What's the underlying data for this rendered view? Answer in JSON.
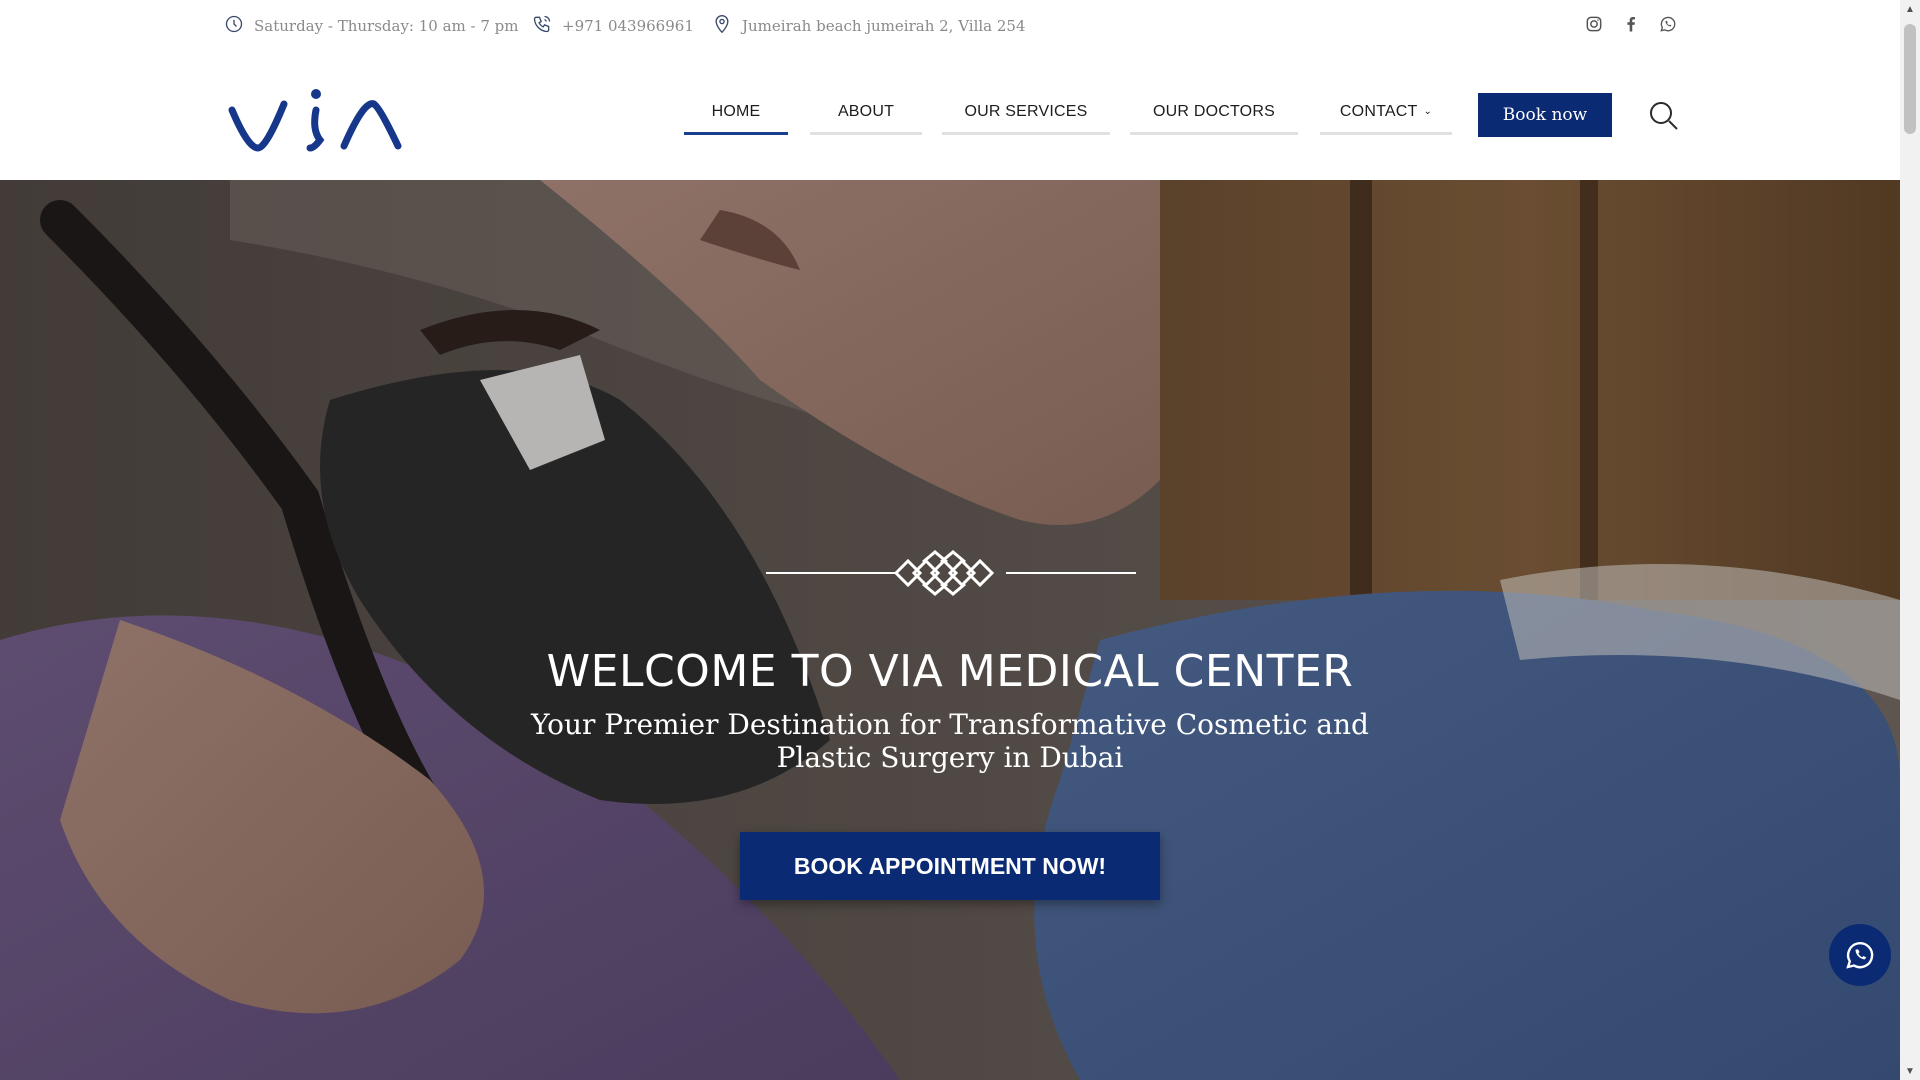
{
  "topbar": {
    "hours": "Saturday - Thursday: 10 am - 7 pm",
    "phone": "+971 043966961",
    "address": "Jumeirah beach jumeirah 2, Villa 254",
    "icons": [
      "clock-icon",
      "phone-icon",
      "location-pin-icon",
      "instagram-icon",
      "facebook-icon",
      "whatsapp-icon"
    ]
  },
  "header": {
    "logo_text": "VIA",
    "nav": [
      {
        "label": "HOME",
        "active": true
      },
      {
        "label": "ABOUT",
        "active": false
      },
      {
        "label": "OUR SERVICES",
        "active": false
      },
      {
        "label": "OUR DOCTORS",
        "active": false
      },
      {
        "label": "CONTACT",
        "active": false,
        "has_dropdown": true
      }
    ],
    "book_now": "Book now"
  },
  "hero": {
    "title": "WELCOME TO VIA MEDICAL CENTER",
    "subtitle": "Your Premier Destination for Transformative Cosmetic and Plastic Surgery in Dubai",
    "cta": "BOOK APPOINTMENT NOW!"
  },
  "colors": {
    "brand": "#0b2a74",
    "nav_active_underline": "#1a3f8c",
    "info_text": "#8a8a8a"
  }
}
